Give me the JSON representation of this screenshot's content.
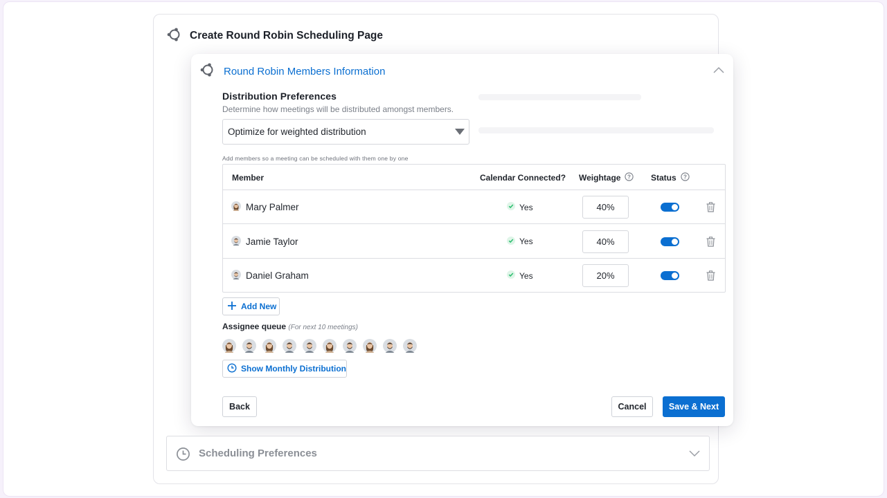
{
  "page": {
    "title": "Create Round Robin Scheduling Page",
    "title_icon": "round-robin-icon"
  },
  "section": {
    "title": "Round Robin Members Information",
    "icon": "round-robin-icon"
  },
  "distribution": {
    "title": "Distribution Preferences",
    "subtitle": "Determine how meetings will be distributed amongst members.",
    "selected": "Optimize for weighted distribution"
  },
  "members_hint": "Add members so a meeting can be scheduled with them one by one",
  "table": {
    "headers": {
      "member": "Member",
      "calendar": "Calendar Connected?",
      "weightage": "Weightage",
      "status": "Status"
    },
    "rows": [
      {
        "name": "Mary Palmer",
        "calendar": "Yes",
        "weight": "40%",
        "status": true,
        "avatar": "female"
      },
      {
        "name": "Jamie Taylor",
        "calendar": "Yes",
        "weight": "40%",
        "status": true,
        "avatar": "male"
      },
      {
        "name": "Daniel Graham",
        "calendar": "Yes",
        "weight": "20%",
        "status": true,
        "avatar": "male"
      }
    ]
  },
  "add_new": "Add New",
  "queue": {
    "label": "Assignee queue",
    "note": "(For next 10 meetings)",
    "avatars": [
      "female",
      "male",
      "female",
      "male",
      "male",
      "female",
      "male",
      "female",
      "male",
      "male"
    ]
  },
  "show_monthly": "Show Monthly Distribution",
  "buttons": {
    "back": "Back",
    "cancel": "Cancel",
    "save": "Save & Next"
  },
  "collapsed_section": {
    "title": "Scheduling Preferences",
    "icon": "clock-icon"
  },
  "colors": {
    "accent": "#0b6fd1",
    "success": "#2fbf71"
  }
}
